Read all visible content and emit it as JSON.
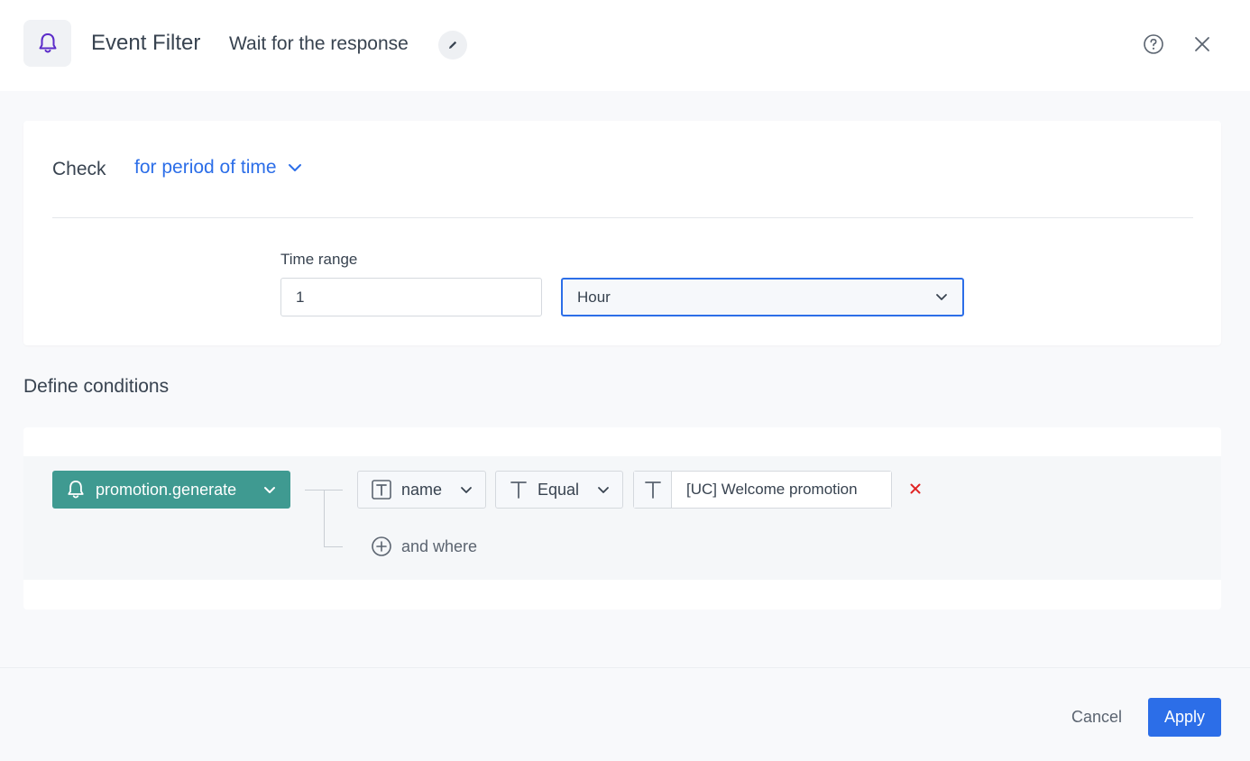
{
  "header": {
    "title": "Event Filter",
    "subtitle": "Wait for the response",
    "icon": "bell-icon",
    "accent_color": "#5b2bc9"
  },
  "check": {
    "label": "Check",
    "mode": "for period of time",
    "time_range_label": "Time range",
    "time_value": "1",
    "time_unit": "Hour"
  },
  "conditions": {
    "title": "Define conditions",
    "event": "promotion.generate",
    "event_color": "#3f9a91",
    "param": "name",
    "operator": "Equal",
    "value": "[UC] Welcome promotion",
    "add_label": "and where"
  },
  "footer": {
    "cancel": "Cancel",
    "apply": "Apply",
    "primary_color": "#2c6ee8"
  }
}
